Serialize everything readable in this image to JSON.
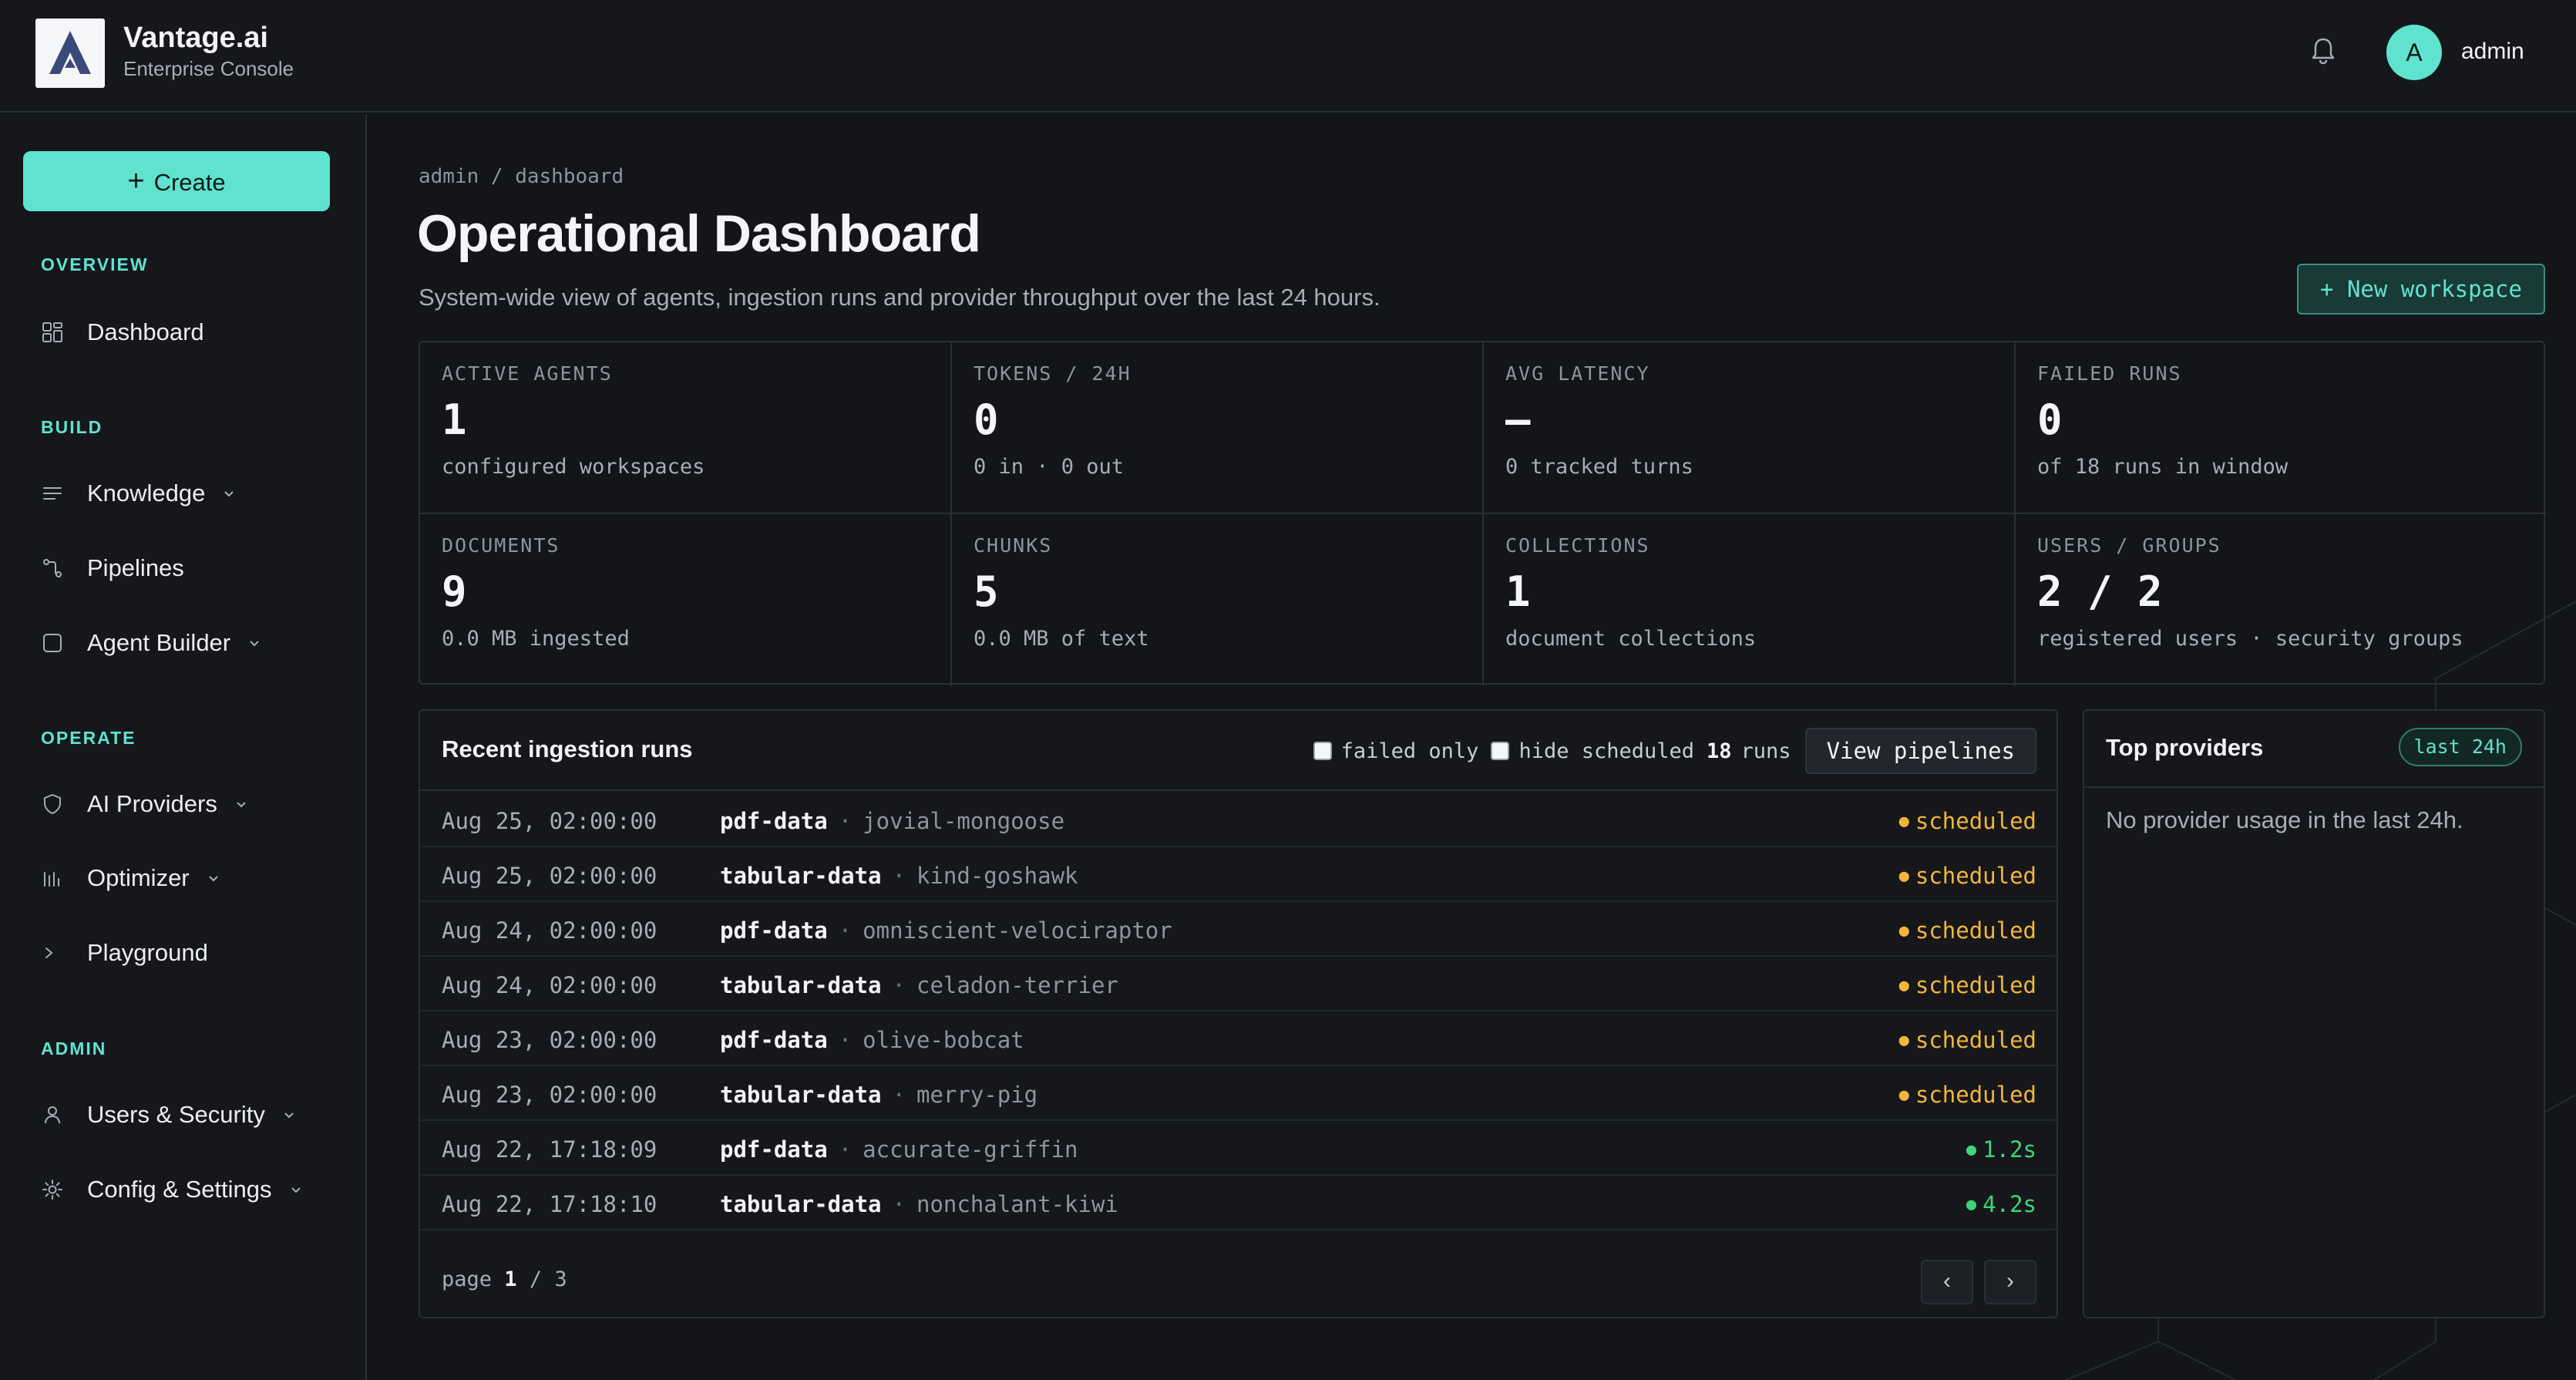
{
  "brand": {
    "name": "Vantage.ai",
    "subtitle": "Enterprise Console"
  },
  "header": {
    "user_initial": "A",
    "user_name": "admin"
  },
  "sidebar": {
    "create_label": "Create",
    "sections": {
      "overview": "OVERVIEW",
      "build": "BUILD",
      "operate": "OPERATE",
      "admin": "ADMIN"
    },
    "items": {
      "dashboard": "Dashboard",
      "knowledge": "Knowledge",
      "pipelines": "Pipelines",
      "agent_builder": "Agent Builder",
      "ai_providers": "AI Providers",
      "optimizer": "Optimizer",
      "playground": "Playground",
      "users_security": "Users & Security",
      "config_settings": "Config & Settings"
    }
  },
  "main": {
    "breadcrumb": "admin / dashboard",
    "title": "Operational Dashboard",
    "subtitle": "System-wide view of agents, ingestion runs and provider throughput over the last 24 hours.",
    "new_workspace_label": "+ New workspace"
  },
  "stats": [
    {
      "label": "ACTIVE AGENTS",
      "value": "1",
      "sub": "configured workspaces"
    },
    {
      "label": "TOKENS / 24H",
      "value": "0",
      "sub": "0 in · 0 out"
    },
    {
      "label": "AVG LATENCY",
      "value": "—",
      "sub": "0 tracked turns"
    },
    {
      "label": "FAILED RUNS",
      "value": "0",
      "sub": "of 18 runs in window"
    },
    {
      "label": "DOCUMENTS",
      "value": "9",
      "sub": "0.0 MB ingested"
    },
    {
      "label": "CHUNKS",
      "value": "5",
      "sub": "0.0 MB of text"
    },
    {
      "label": "COLLECTIONS",
      "value": "1",
      "sub": "document collections"
    },
    {
      "label": "USERS / GROUPS",
      "value": "2 / 2",
      "sub": "registered users · security groups"
    }
  ],
  "runs": {
    "title": "Recent ingestion runs",
    "filter_failed": "failed only",
    "filter_hide_scheduled": "hide scheduled",
    "count": "18",
    "count_label": "runs",
    "view_label": "View pipelines",
    "rows": [
      {
        "time": "Aug 25, 02:00:00",
        "pipeline": "pdf-data",
        "sep": "·",
        "run": "jovial-mongoose",
        "status": "scheduled"
      },
      {
        "time": "Aug 25, 02:00:00",
        "pipeline": "tabular-data",
        "sep": "·",
        "run": "kind-goshawk",
        "status": "scheduled"
      },
      {
        "time": "Aug 24, 02:00:00",
        "pipeline": "pdf-data",
        "sep": "·",
        "run": "omniscient-velociraptor",
        "status": "scheduled"
      },
      {
        "time": "Aug 24, 02:00:00",
        "pipeline": "tabular-data",
        "sep": "·",
        "run": "celadon-terrier",
        "status": "scheduled"
      },
      {
        "time": "Aug 23, 02:00:00",
        "pipeline": "pdf-data",
        "sep": "·",
        "run": "olive-bobcat",
        "status": "scheduled"
      },
      {
        "time": "Aug 23, 02:00:00",
        "pipeline": "tabular-data",
        "sep": "·",
        "run": "merry-pig",
        "status": "scheduled"
      },
      {
        "time": "Aug 22, 17:18:09",
        "pipeline": "pdf-data",
        "sep": "·",
        "run": "accurate-griffin",
        "status": "1.2s"
      },
      {
        "time": "Aug 22, 17:18:10",
        "pipeline": "tabular-data",
        "sep": "·",
        "run": "nonchalant-kiwi",
        "status": "4.2s"
      }
    ],
    "page_label": "page",
    "page_current": "1",
    "page_sep": "/ 3",
    "prev_label": "‹",
    "next_label": "›"
  },
  "providers": {
    "title": "Top providers",
    "badge": "last 24h",
    "empty": "No provider usage in the last 24h."
  },
  "colors": {
    "accent": "#5fe3cf",
    "scheduled": "#f4b63a",
    "success": "#3fd37a",
    "background": "#131519"
  }
}
